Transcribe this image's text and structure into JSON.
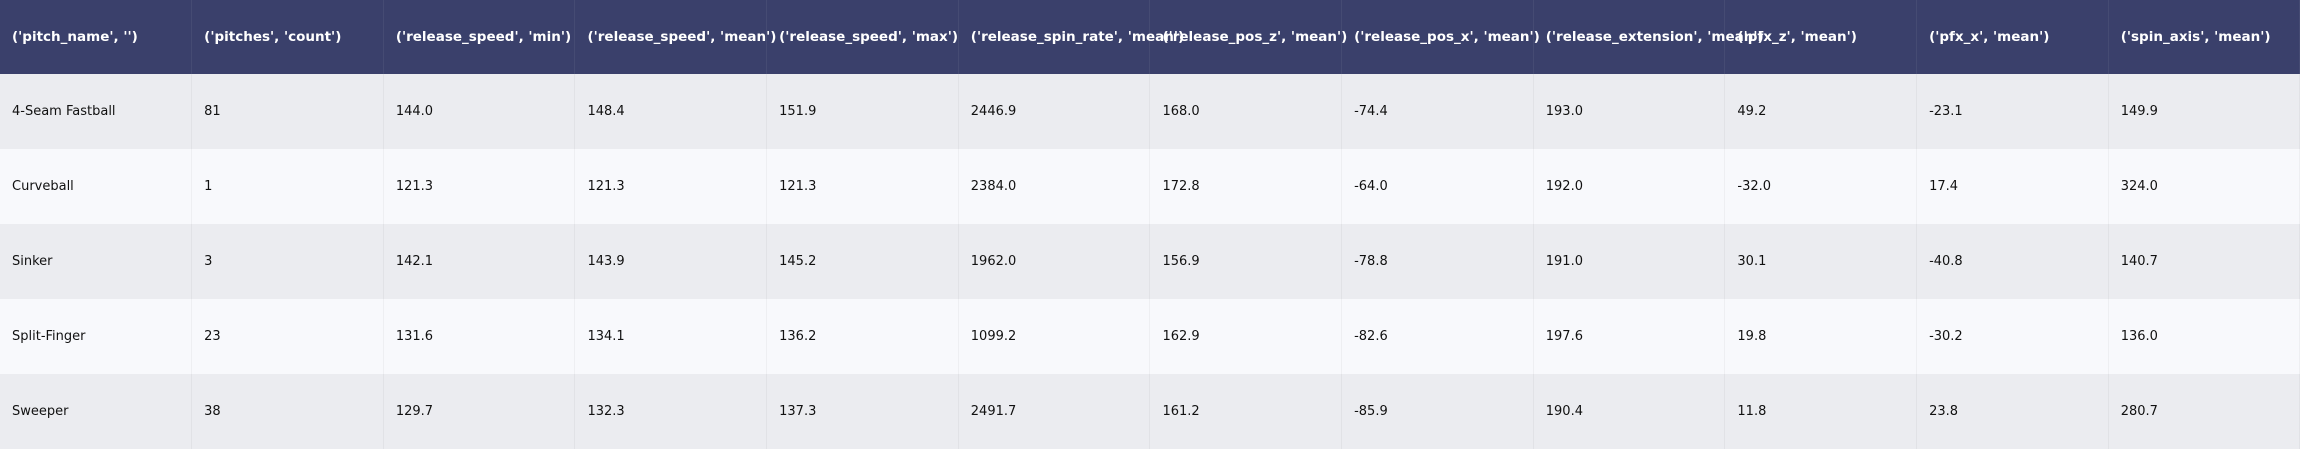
{
  "chart_data": {
    "type": "table",
    "columns": [
      "('pitch_name', '')",
      "('pitches', 'count')",
      "('release_speed', 'min')",
      "('release_speed', 'mean')",
      "('release_speed', 'max')",
      "('release_spin_rate', 'mean')",
      "('release_pos_z', 'mean')",
      "('release_pos_x', 'mean')",
      "('release_extension', 'mean')",
      "('pfx_z', 'mean')",
      "('pfx_x', 'mean')",
      "('spin_axis', 'mean')"
    ],
    "rows": [
      [
        "4-Seam Fastball",
        "81",
        "144.0",
        "148.4",
        "151.9",
        "2446.9",
        "168.0",
        "-74.4",
        "193.0",
        "49.2",
        "-23.1",
        "149.9"
      ],
      [
        "Curveball",
        "1",
        "121.3",
        "121.3",
        "121.3",
        "2384.0",
        "172.8",
        "-64.0",
        "192.0",
        "-32.0",
        "17.4",
        "324.0"
      ],
      [
        "Sinker",
        "3",
        "142.1",
        "143.9",
        "145.2",
        "1962.0",
        "156.9",
        "-78.8",
        "191.0",
        "30.1",
        "-40.8",
        "140.7"
      ],
      [
        "Split-Finger",
        "23",
        "131.6",
        "134.1",
        "136.2",
        "1099.2",
        "162.9",
        "-82.6",
        "197.6",
        "19.8",
        "-30.2",
        "136.0"
      ],
      [
        "Sweeper",
        "38",
        "129.7",
        "132.3",
        "137.3",
        "2491.7",
        "161.2",
        "-85.9",
        "190.4",
        "11.8",
        "23.8",
        "280.7"
      ]
    ],
    "header_color": "#3a406b",
    "row_colors": [
      "#ebecf0",
      "#f8f9fc"
    ]
  }
}
